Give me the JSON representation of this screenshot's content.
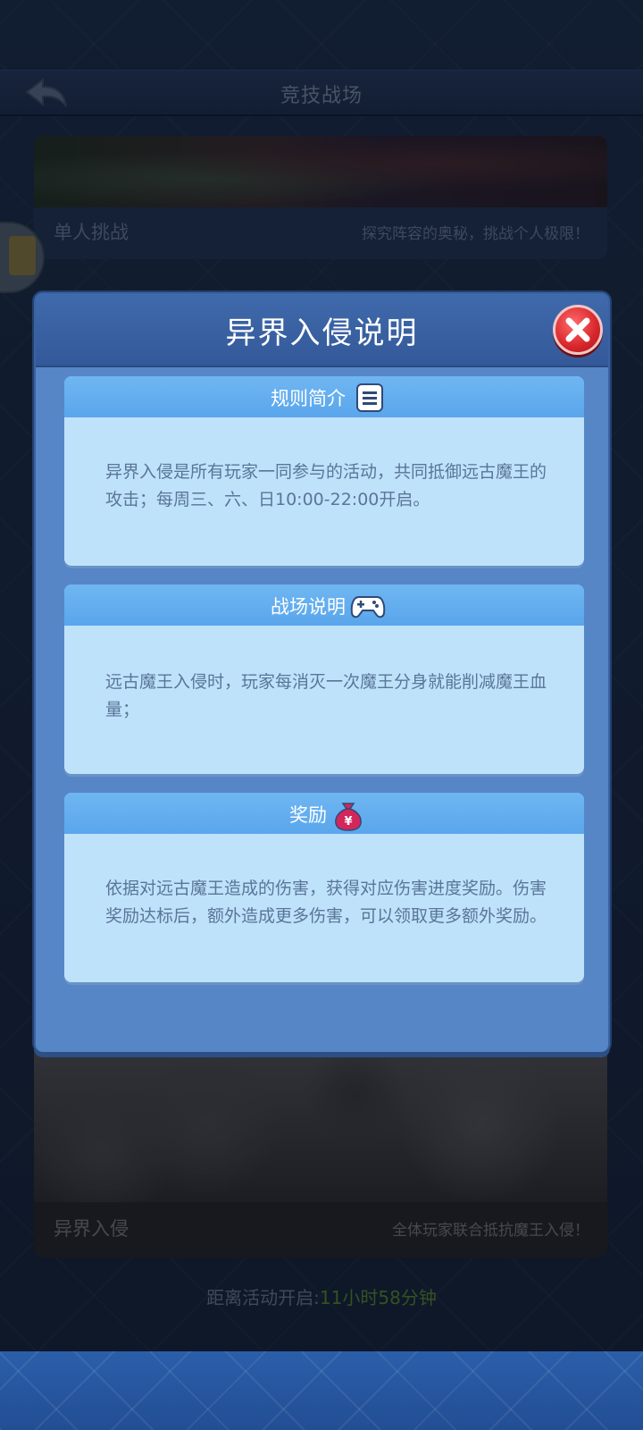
{
  "header": {
    "title": "竞技战场"
  },
  "cards": {
    "single": {
      "name": "单人挑战",
      "desc": "探究阵容的奥秘，挑战个人极限！"
    },
    "invasion": {
      "name": "异界入侵",
      "desc": "全体玩家联合抵抗魔王入侵！"
    }
  },
  "countdown": {
    "label": "距离活动开启:",
    "time": "11小时58分钟"
  },
  "dialog": {
    "title": "异界入侵说明",
    "sections": [
      {
        "title": "规则简介",
        "icon": "document-icon",
        "text": "异界入侵是所有玩家一同参与的活动，共同抵御远古魔王的攻击；每周三、六、日10:00-22:00开启。"
      },
      {
        "title": "战场说明",
        "icon": "gamepad-icon",
        "text": "远古魔王入侵时，玩家每消灭一次魔王分身就能削减魔王血量；"
      },
      {
        "title": "奖励",
        "icon": "money-bag-icon",
        "text": "依据对远古魔王造成的伤害，获得对应伤害进度奖励。伤害奖励达标后，额外造成更多伤害，可以领取更多额外奖励。"
      }
    ]
  },
  "colors": {
    "dialog_bg": "#5686c6",
    "section_bg": "#bfe2fb",
    "section_header": "#5aa6ec",
    "close_red": "#d7262c",
    "countdown_time": "#5a8a2e"
  }
}
